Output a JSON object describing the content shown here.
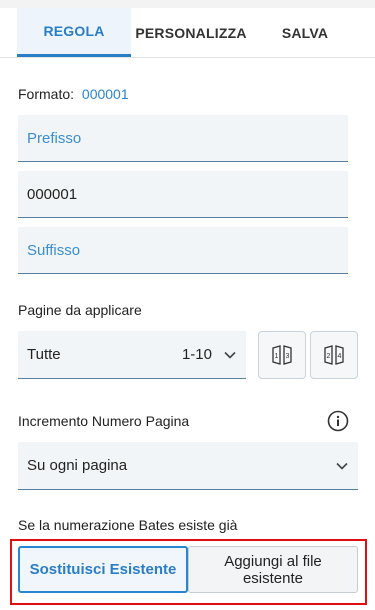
{
  "tabs": [
    "REGOLA",
    "PERSONALIZZA",
    "SALVA"
  ],
  "format": {
    "label": "Formato:",
    "value": "000001"
  },
  "prefix": {
    "placeholder": "Prefisso"
  },
  "number": {
    "value": "000001"
  },
  "suffix": {
    "placeholder": "Suffisso"
  },
  "pages": {
    "label": "Pagine da applicare",
    "selected": "Tutte",
    "range": "1-10"
  },
  "increment": {
    "label": "Incremento Numero Pagina",
    "selected": "Su ogni pagina"
  },
  "existing": {
    "label": "Se la numerazione Bates esiste già",
    "options": [
      "Sostituisci Esistente",
      "Aggiungi al file esistente"
    ]
  },
  "colors": {
    "accent": "#2a7ec6",
    "highlight": "#e10f0f"
  },
  "icons": [
    "odd-pages-icon",
    "even-pages-icon",
    "info-icon",
    "chevron-down-icon"
  ]
}
